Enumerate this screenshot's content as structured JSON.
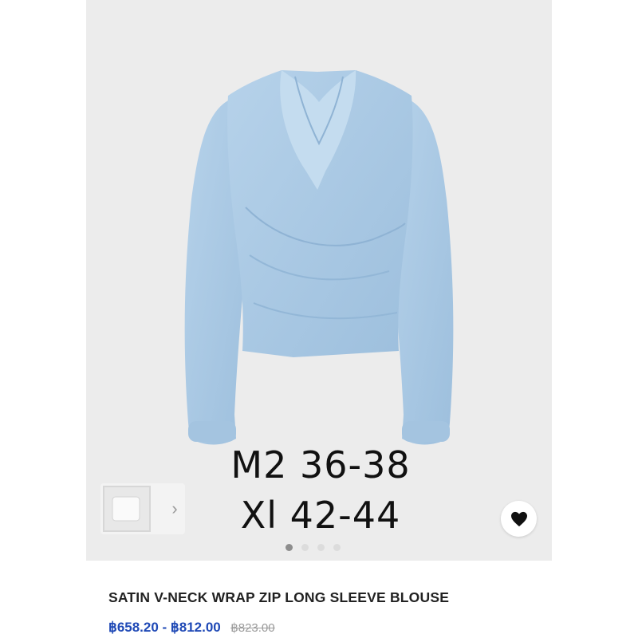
{
  "product": {
    "title": "SATIN V-NECK WRAP ZIP LONG SLEEVE BLOUSE",
    "price_range": "฿658.20 - ฿812.00",
    "original_price": "฿823.00",
    "image_alt": "Light blue satin wrap blouse"
  },
  "overlay_text": {
    "line1": "M2 36-38",
    "line2": "Xl 42-44"
  },
  "gallery": {
    "total_images": 4,
    "active_index": 0
  },
  "colors": {
    "blouse": "#a9c8e3",
    "price": "#1f49b6",
    "background": "#ececec"
  },
  "icons": {
    "favorite": "heart-icon",
    "next": "chevron-right-icon"
  }
}
